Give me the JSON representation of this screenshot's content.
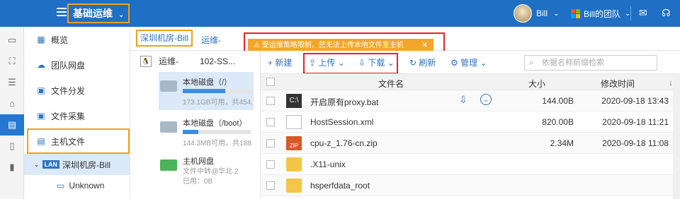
{
  "header": {
    "title": "基础运维",
    "user_name": "Bill",
    "team_label": "Bill的团队",
    "brand_colors": [
      "#f25022",
      "#7fba00",
      "#00a4ef",
      "#ffb900"
    ]
  },
  "rail": {
    "icons": [
      "monitor-icon",
      "sitemap-icon",
      "database-icon",
      "cloud-drive-icon",
      "file-manager-icon",
      "clipboard-icon",
      "clipboard-check-icon"
    ]
  },
  "sidebar": {
    "items": [
      {
        "label": "概览",
        "icon": "overview-icon"
      },
      {
        "label": "团队网盘",
        "icon": "cloud-icon"
      },
      {
        "label": "文件分发",
        "icon": "file-distribute-icon"
      },
      {
        "label": "文件采集",
        "icon": "file-collect-icon"
      },
      {
        "label": "主机文件",
        "icon": "host-file-icon"
      }
    ],
    "sub_lan": "LAN",
    "sub_item": "深圳机房-Bill",
    "sub_sub_item": "Unknown"
  },
  "breadcrumb": {
    "first": "深圳机房-Bill",
    "rest": "运维-"
  },
  "alert": {
    "text": "受运维策略限制，您无法上传本地文件至主机"
  },
  "host": {
    "name": "运维-",
    "suffix": "102-SS..."
  },
  "disks": [
    {
      "name": "本地磁盘（/）",
      "info": "173.1GB可用，共454...",
      "used": 0.62
    },
    {
      "name": "本地磁盘（/boot）",
      "info": "144.3MB可用，共188...",
      "used": 0.23
    },
    {
      "name": "主机网盘",
      "info": "文件中转@华北 2",
      "info2": "已用：0B"
    }
  ],
  "toolbar": {
    "new": "新建",
    "upload": "上传",
    "download": "下载",
    "refresh": "刷新",
    "manage": "管理",
    "search_placeholder": "依据名称前缀检索"
  },
  "table": {
    "columns": {
      "name": "文件名",
      "size": "大小",
      "time": "修改时间"
    },
    "rows": [
      {
        "name": "开启原有proxy.bat",
        "size": "144.00B",
        "time": "2020-09-18 13:43"
      },
      {
        "name": "HostSession.xml",
        "size": "820.00B",
        "time": "2020-09-18 11:21"
      },
      {
        "name": "cpu-z_1.76-cn.zip",
        "size": "2.34M",
        "time": "2020-09-18 11:08"
      },
      {
        "name": ".X11-unix",
        "size": "",
        "time": ""
      },
      {
        "name": "hsperfdata_root",
        "size": "",
        "time": ""
      }
    ]
  }
}
